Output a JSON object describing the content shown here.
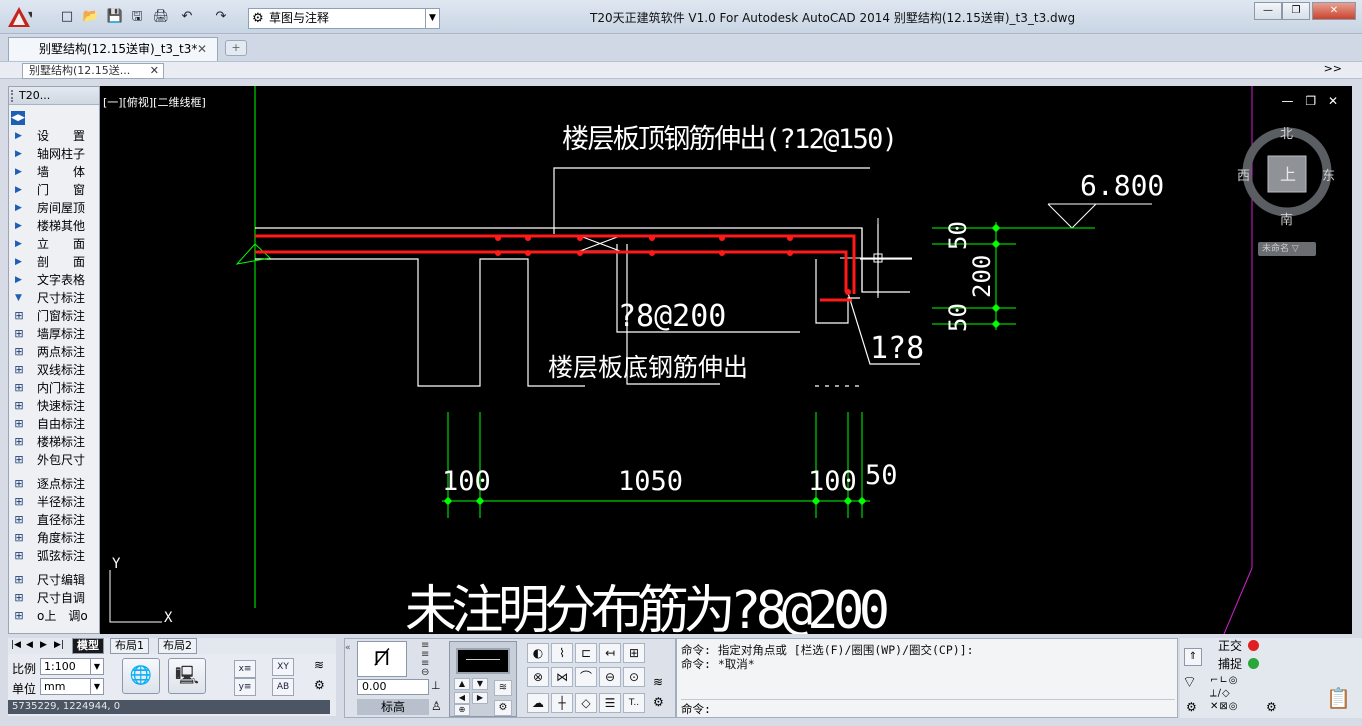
{
  "window": {
    "title": "T20天正建筑软件 V1.0 For Autodesk AutoCAD 2014     别墅结构(12.15送审)_t3_t3.dwg",
    "workspace": "草图与注释",
    "min": "—",
    "restore": "❐",
    "close": "✕"
  },
  "quick_access": [
    "□",
    "📂",
    "💾",
    "🖫",
    "🖨",
    "↶",
    "↷"
  ],
  "doc_tab": {
    "label": "别墅结构(12.15送审)_t3_t3*",
    "close": "✕"
  },
  "sub_tab": {
    "label": "别墅结构(12.15送...",
    "close": "✕",
    "more": ">>"
  },
  "palette": {
    "title": "T20...",
    "categories": [
      "设　　置",
      "轴网柱子",
      "墙　　体",
      "门　　窗",
      "房间屋顶",
      "楼梯其他",
      "立　　面",
      "剖　　面",
      "文字表格",
      "尺寸标注"
    ],
    "dim_tools": [
      "门窗标注",
      "墙厚标注",
      "两点标注",
      "双线标注",
      "内门标注",
      "快速标注",
      "自由标注",
      "楼梯标注",
      "外包尺寸"
    ],
    "dim_tools2": [
      "逐点标注",
      "半径标注",
      "直径标注",
      "角度标注",
      "弧弦标注"
    ],
    "dim_tools3": [
      "尺寸编辑",
      "尺寸自调",
      "o上　调o"
    ]
  },
  "canvas": {
    "view_label": "[一][俯视][二维线框]",
    "viewport_controls": [
      "—",
      "❐",
      "✕"
    ],
    "viewcube": {
      "n": "北",
      "s": "南",
      "w": "西",
      "e": "东",
      "top": "上"
    },
    "unnamed": "未命名 ▽",
    "texts": {
      "top_rebar": "楼层板顶钢筋伸出(?12@150)",
      "elevation": "6.800",
      "dim_50a": "50",
      "dim_200": "200",
      "dim_50b": "50",
      "stirrup": "?8@200",
      "corner_bar": "1?8",
      "bottom_rebar": "楼层板底钢筋伸出",
      "dim_100a": "100",
      "dim_1050": "1050",
      "dim_100b": "100",
      "dim_50c": "50",
      "note": "未注明分布筋为?8@200",
      "ucs_y": "Y",
      "ucs_x": "X"
    }
  },
  "layout_tabs": {
    "model": "模型",
    "layout1": "布局1",
    "layout2": "布局2"
  },
  "bottom": {
    "scale_label": "比例",
    "scale_value": "1:100",
    "unit_label": "单位",
    "unit_value": "mm",
    "coords": "5735229, 1224944, 0",
    "elev_value": "0.00",
    "elev_label": "标高"
  },
  "command": {
    "history_1": "命令: 指定对角点或 [栏选(F)/圈围(WP)/圈交(CP)]:",
    "history_2": "命令: *取消*",
    "prompt": "命令:"
  },
  "status": {
    "ortho": "正交",
    "snap": "捕捉",
    "ortho_color": "#e02020",
    "snap_color": "#2aa63a"
  },
  "colors": {
    "rebar": "#ff1a1a",
    "dim": "#00ff00",
    "outline": "#ffffff",
    "axis_magenta": "#d020d0"
  }
}
